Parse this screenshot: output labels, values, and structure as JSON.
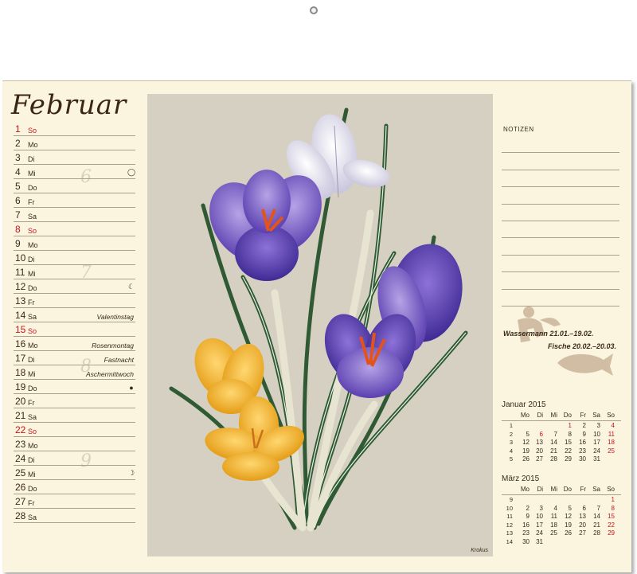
{
  "month_title": "Februar",
  "days": [
    {
      "num": "1",
      "wd": "So",
      "sun": true,
      "note": "",
      "moon": ""
    },
    {
      "num": "2",
      "wd": "Mo",
      "sun": false,
      "note": "",
      "moon": ""
    },
    {
      "num": "3",
      "wd": "Di",
      "sun": false,
      "note": "",
      "moon": ""
    },
    {
      "num": "4",
      "wd": "Mi",
      "sun": false,
      "note": "",
      "moon": "◯"
    },
    {
      "num": "5",
      "wd": "Do",
      "sun": false,
      "note": "",
      "moon": ""
    },
    {
      "num": "6",
      "wd": "Fr",
      "sun": false,
      "note": "",
      "moon": ""
    },
    {
      "num": "7",
      "wd": "Sa",
      "sun": false,
      "note": "",
      "moon": ""
    },
    {
      "num": "8",
      "wd": "So",
      "sun": true,
      "note": "",
      "moon": ""
    },
    {
      "num": "9",
      "wd": "Mo",
      "sun": false,
      "note": "",
      "moon": ""
    },
    {
      "num": "10",
      "wd": "Di",
      "sun": false,
      "note": "",
      "moon": ""
    },
    {
      "num": "11",
      "wd": "Mi",
      "sun": false,
      "note": "",
      "moon": ""
    },
    {
      "num": "12",
      "wd": "Do",
      "sun": false,
      "note": "",
      "moon": "☾"
    },
    {
      "num": "13",
      "wd": "Fr",
      "sun": false,
      "note": "",
      "moon": ""
    },
    {
      "num": "14",
      "wd": "Sa",
      "sun": false,
      "note": "Valentinstag",
      "moon": ""
    },
    {
      "num": "15",
      "wd": "So",
      "sun": true,
      "note": "",
      "moon": ""
    },
    {
      "num": "16",
      "wd": "Mo",
      "sun": false,
      "note": "Rosenmontag",
      "moon": ""
    },
    {
      "num": "17",
      "wd": "Di",
      "sun": false,
      "note": "Fastnacht",
      "moon": ""
    },
    {
      "num": "18",
      "wd": "Mi",
      "sun": false,
      "note": "Aschermittwoch",
      "moon": ""
    },
    {
      "num": "19",
      "wd": "Do",
      "sun": false,
      "note": "",
      "moon": "●"
    },
    {
      "num": "20",
      "wd": "Fr",
      "sun": false,
      "note": "",
      "moon": ""
    },
    {
      "num": "21",
      "wd": "Sa",
      "sun": false,
      "note": "",
      "moon": ""
    },
    {
      "num": "22",
      "wd": "So",
      "sun": true,
      "note": "",
      "moon": ""
    },
    {
      "num": "23",
      "wd": "Mo",
      "sun": false,
      "note": "",
      "moon": ""
    },
    {
      "num": "24",
      "wd": "Di",
      "sun": false,
      "note": "",
      "moon": ""
    },
    {
      "num": "25",
      "wd": "Mi",
      "sun": false,
      "note": "",
      "moon": "☽"
    },
    {
      "num": "26",
      "wd": "Do",
      "sun": false,
      "note": "",
      "moon": ""
    },
    {
      "num": "27",
      "wd": "Fr",
      "sun": false,
      "note": "",
      "moon": ""
    },
    {
      "num": "28",
      "wd": "Sa",
      "sun": false,
      "note": "",
      "moon": ""
    }
  ],
  "week_numbers": [
    "6",
    "7",
    "8",
    "9"
  ],
  "artwork_caption": "Krokus",
  "notes_label": "NOTIZEN",
  "zodiac": {
    "line1": "Wassermann 21.01.–19.02.",
    "line2": "Fische 20.02.–20.03."
  },
  "mini_calendars": [
    {
      "title": "Januar 2015",
      "headers": [
        "Mo",
        "Di",
        "Mi",
        "Do",
        "Fr",
        "Sa",
        "So"
      ],
      "rows": [
        {
          "wk": "1",
          "cells": [
            "",
            "",
            "",
            "1",
            "2",
            "3",
            "4"
          ]
        },
        {
          "wk": "2",
          "cells": [
            "5",
            "6",
            "7",
            "8",
            "9",
            "10",
            "11"
          ]
        },
        {
          "wk": "3",
          "cells": [
            "12",
            "13",
            "14",
            "15",
            "16",
            "17",
            "18"
          ]
        },
        {
          "wk": "4",
          "cells": [
            "19",
            "20",
            "21",
            "22",
            "23",
            "24",
            "25"
          ]
        },
        {
          "wk": "5",
          "cells": [
            "26",
            "27",
            "28",
            "29",
            "30",
            "31",
            ""
          ]
        }
      ],
      "holidays": [
        "1",
        "6"
      ]
    },
    {
      "title": "März 2015",
      "headers": [
        "Mo",
        "Di",
        "Mi",
        "Do",
        "Fr",
        "Sa",
        "So"
      ],
      "rows": [
        {
          "wk": "9",
          "cells": [
            "",
            "",
            "",
            "",
            "",
            "",
            "1"
          ]
        },
        {
          "wk": "10",
          "cells": [
            "2",
            "3",
            "4",
            "5",
            "6",
            "7",
            "8"
          ]
        },
        {
          "wk": "11",
          "cells": [
            "9",
            "10",
            "11",
            "12",
            "13",
            "14",
            "15"
          ]
        },
        {
          "wk": "12",
          "cells": [
            "16",
            "17",
            "18",
            "19",
            "20",
            "21",
            "22"
          ]
        },
        {
          "wk": "13",
          "cells": [
            "23",
            "24",
            "25",
            "26",
            "27",
            "28",
            "29"
          ]
        },
        {
          "wk": "14",
          "cells": [
            "30",
            "31",
            "",
            "",
            "",
            "",
            ""
          ]
        }
      ],
      "holidays": []
    }
  ]
}
